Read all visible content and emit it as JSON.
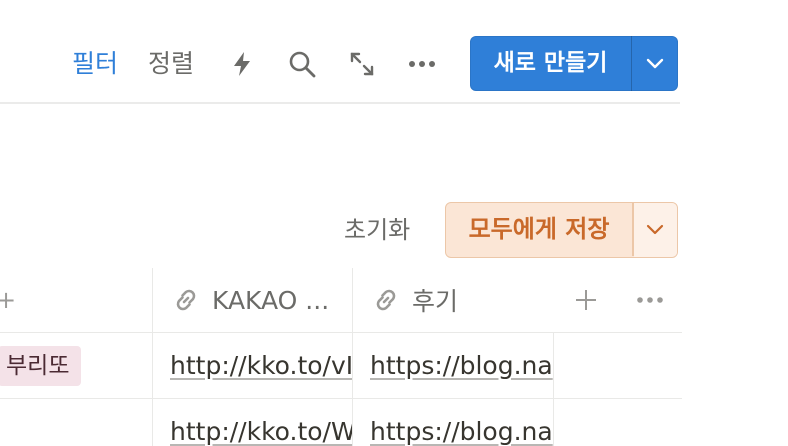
{
  "toolbar": {
    "filter_label": "필터",
    "sort_label": "정렬",
    "icons": [
      "bolt-icon",
      "search-icon",
      "expand-icon",
      "more-icon"
    ],
    "new_button_label": "새로 만들기",
    "accent_color": "#2f7fd8"
  },
  "view_controls": {
    "reset_label": "초기화",
    "save_label": "모두에게 저장",
    "save_color": "#c9692a"
  },
  "table": {
    "partial_header": "+",
    "columns": [
      {
        "icon": "link-icon",
        "label": "KAKAO ..."
      },
      {
        "icon": "link-icon",
        "label": "후기"
      }
    ],
    "rows": [
      {
        "tag": "부리또",
        "kakao": "http://kko.to/vI",
        "review": "https://blog.na"
      },
      {
        "tag": "",
        "kakao": "http://kko.to/W",
        "review": "https://blog.na"
      }
    ]
  }
}
